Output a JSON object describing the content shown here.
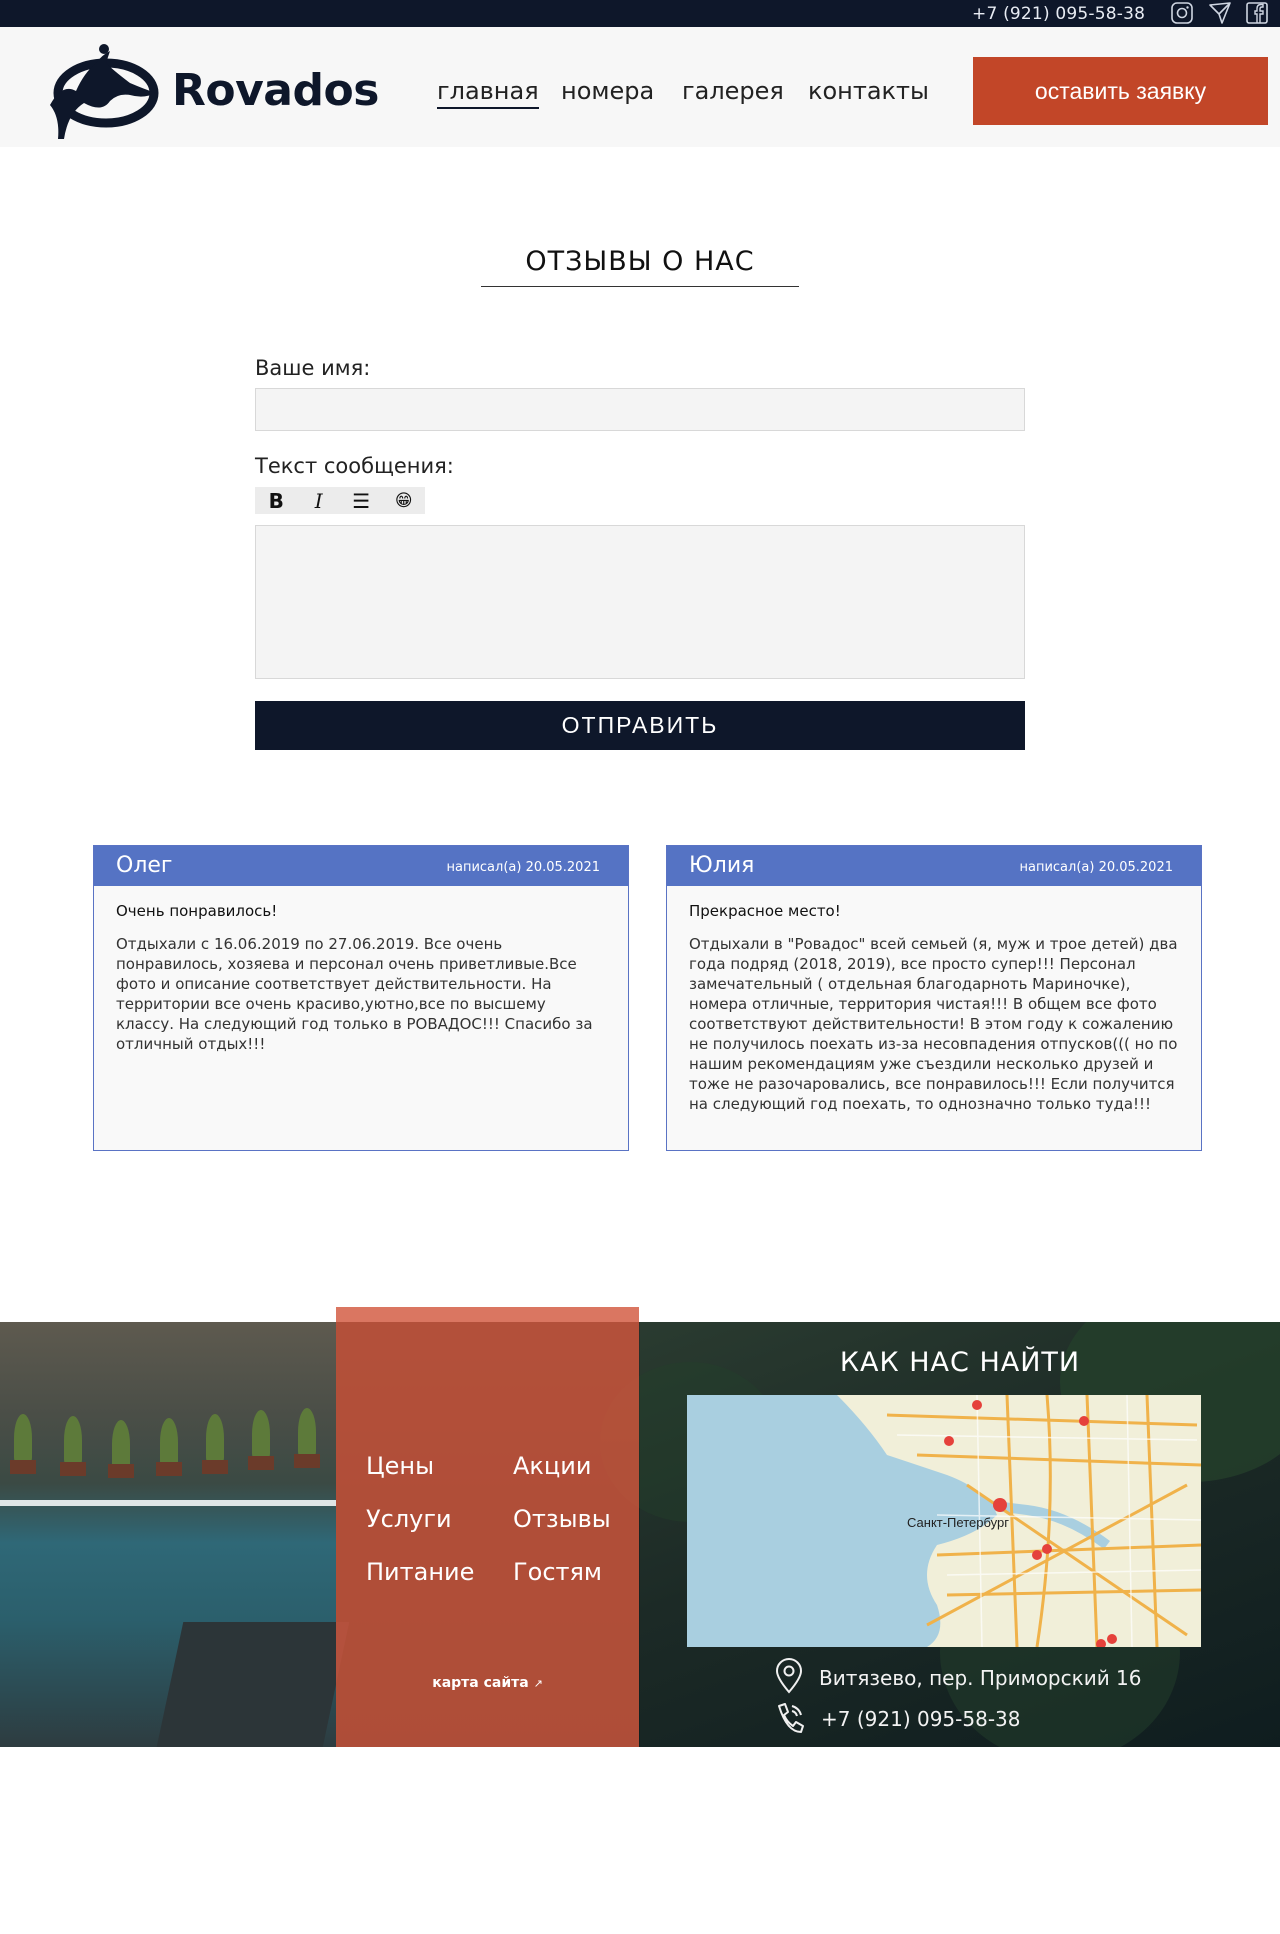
{
  "topbar": {
    "phone": "+7 (921) 095-58-38",
    "icons": [
      "instagram-icon",
      "telegram-icon",
      "facebook-icon"
    ]
  },
  "header": {
    "brand": "Rovados",
    "nav": [
      "главная",
      "номера",
      "галерея",
      "контакты"
    ],
    "active_nav": "главная",
    "cta": "оставить заявку"
  },
  "reviews_form": {
    "title": "ОТЗЫВЫ О НАС",
    "name_label": "Ваше имя:",
    "name_value": "",
    "message_label": "Текст сообщения:",
    "message_value": "",
    "toolbar": [
      "B",
      "I",
      "☰",
      "😁"
    ],
    "submit": "ОТПРАВИТЬ"
  },
  "reviews": [
    {
      "author": "Олег",
      "date": "написал(а) 20.05.2021",
      "title": "Очень понравилось!",
      "text": "Отдыхали с 16.06.2019 по 27.06.2019. Все очень понравилось, хозяева и персонал очень приветливые.Все фото и описание соответствует действительности. На территории все очень красиво,уютно,все по высшему классу. На следующий год только в РОВАДОС!!! Спасибо за отличный отдых!!!"
    },
    {
      "author": "Юлия",
      "date": "написал(а) 20.05.2021",
      "title": "Прекрасное место!",
      "text": "Отдыхали в \"Ровадос\" всей семьей (я, муж и трое детей) два года подряд (2018, 2019), все просто супер!!! Персонал замечательный ( отдельная благодарноть Мариночке), номера отличные, территория чистая!!! В общем все фото соответствуют действительности! В этом году к сожалению не получилось поехать из-за несовпадения отпусков((( но по нашим рекомендациям уже съездили несколько друзей и тоже не разочаровались, все понравилось!!! Если получится на следующий год поехать, то однозначно только туда!!!"
    }
  ],
  "footer": {
    "links": [
      "Цены",
      "Акции",
      "Услуги",
      "Отзывы",
      "Питание",
      "Гостям"
    ],
    "sitemap": "карта сайта",
    "find_title": "КАК НАС НАЙТИ",
    "map_city": "Санкт-Петербург",
    "address": "Витязево, пер. Приморский 16",
    "phone": "+7 (921) 095-58-38"
  },
  "colors": {
    "navy": "#0e172a",
    "accent": "#c24628",
    "review_header": "#5573c4",
    "footer_panel": "#d2583e"
  }
}
